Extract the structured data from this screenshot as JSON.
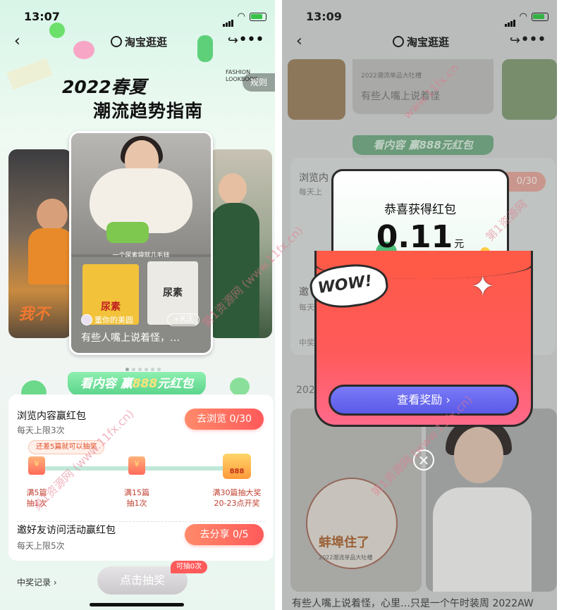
{
  "left": {
    "status_time": "13:07",
    "nav": {
      "back": "‹",
      "logo": "淘宝逛逛",
      "share": "↪",
      "more": "•••"
    },
    "hero": {
      "title": "2022春夏",
      "subtitle": "潮流趋势指南",
      "tag": "FASHION LOOKBOOK"
    },
    "rules_label": "规则",
    "side_card_left_text": "我不",
    "main_card": {
      "caption": "一个尿素袋就几毛钱",
      "pkg1_text": "尿素",
      "pkg2_text": "尿素",
      "author": "董你的美圆",
      "follow_label": "+关注",
      "desc": "有些人嘴上说着怪，…"
    },
    "banner": {
      "pre": "看内容 赢",
      "gold": "888",
      "post": "元红包"
    },
    "tasks": [
      {
        "title": "浏览内容赢红包",
        "sub": "每天上限3次",
        "button": "去浏览 0/30"
      },
      {
        "title": "邀好友访问活动赢红包",
        "sub": "每天上限5次",
        "button": "去分享 0/5"
      }
    ],
    "progress_tip": "还差5篇就可以抽奖",
    "progress_big_label": "888",
    "milestones": [
      {
        "l1": "满5篇",
        "l2": "抽1次"
      },
      {
        "l1": "满15篇",
        "l2": "抽1次"
      },
      {
        "l1": "满30篇抽大奖",
        "l2": "20-23点开奖"
      }
    ],
    "record_label": "中奖记录 ›",
    "draw_label": "点击抽奖",
    "draw_badge": "可抽0次"
  },
  "right": {
    "status_time": "13:09",
    "nav": {
      "back": "‹",
      "logo": "淘宝逛逛",
      "share": "↪",
      "more": "•••"
    },
    "mini_card_title": "有些人嘴上说着怪",
    "mini_card_author": "2022潮流单品大吐槽",
    "banner": "看内容 赢888元红包",
    "panel_task1": "浏览内",
    "panel_task1_sub": "每天上",
    "panel_task1_count": "0/30",
    "panel_task2": "邀",
    "panel_task2_sub": "每天",
    "panel_record": "中奖",
    "feed_title": "2022",
    "feed_left_label": "蚌埠住了",
    "feed_left_caption": "2022潮流单品大吐槽",
    "bottom_text": "有些人嘴上说着怪，心里…只是一个午时装周 2022AW",
    "popup": {
      "header": "恭喜获得红包",
      "amount": "0.11",
      "unit": "元",
      "wow": "WOW!",
      "button": "查看奖励 ›",
      "close": "×"
    }
  },
  "watermarks": [
    "第1资源网 (www.11fx.cn)",
    "第1资源网 (www.11fx.cn)",
    "第1资源网 (www.11fx.cn)",
    "www.11fx.cn",
    "第1资源网"
  ],
  "colors": {
    "accent_red": "#ff5a5a",
    "accent_green": "#5ad28a",
    "button_purple": "#6a6af0",
    "gold": "#ffe37a"
  }
}
